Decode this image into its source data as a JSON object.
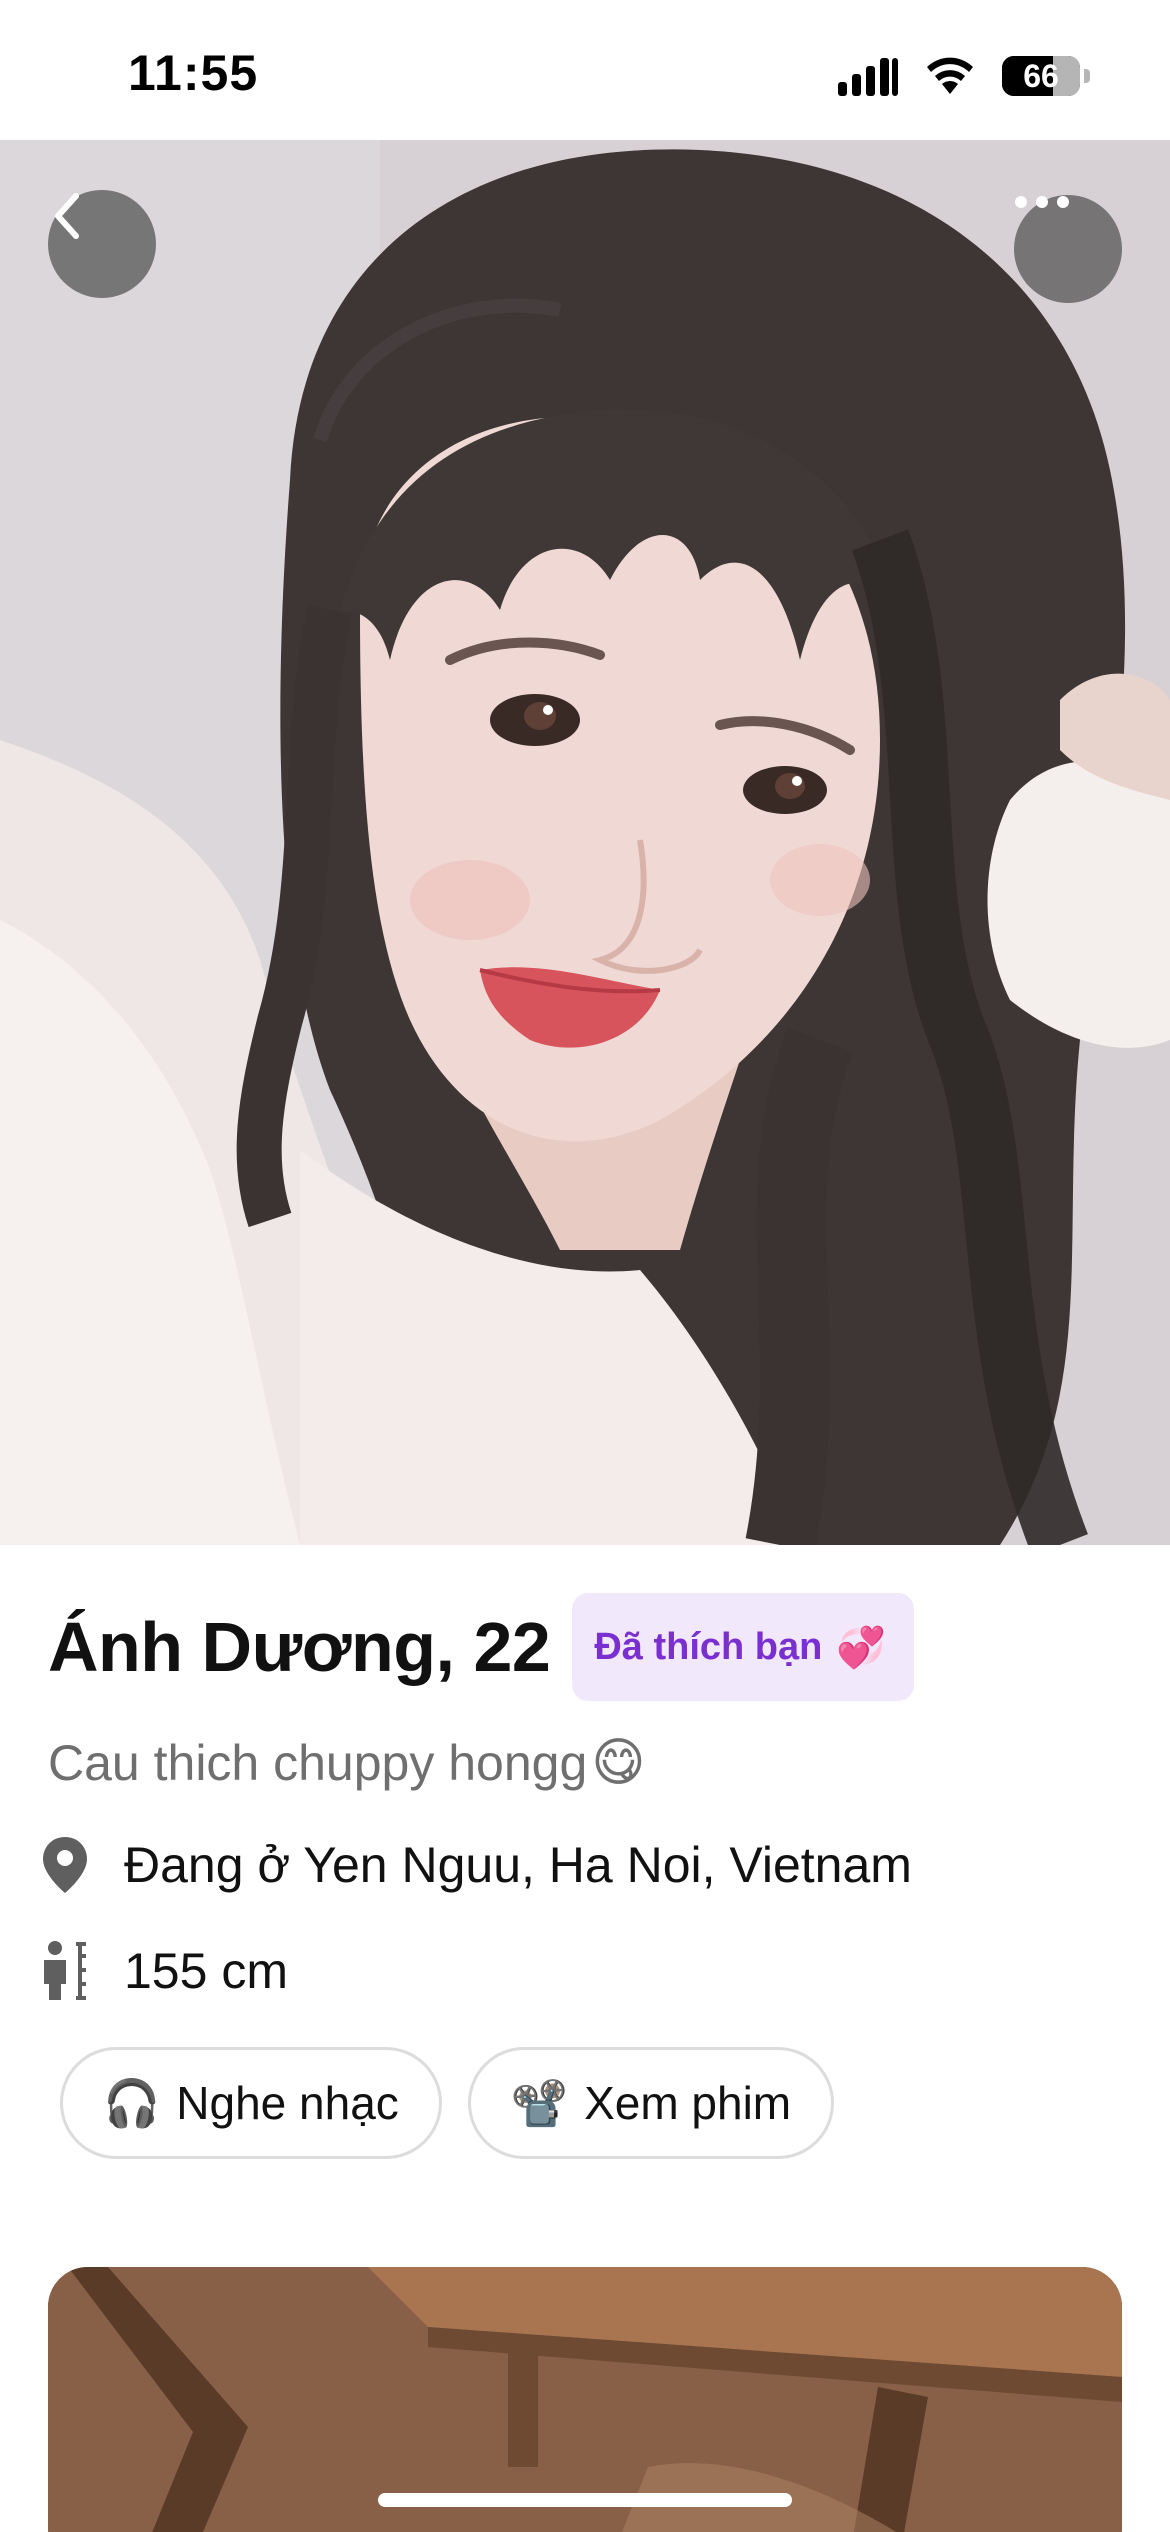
{
  "status_bar": {
    "time": "11:55",
    "battery_level": "66",
    "battery_fraction": 0.66,
    "icons": [
      "cellular-signal-icon",
      "wifi-icon",
      "battery-icon"
    ]
  },
  "hero": {
    "back_icon": "chevron-left-icon",
    "more_icon": "ellipsis-icon"
  },
  "profile": {
    "name_age": "Ánh Dương, 22",
    "liked_badge": "Đã thích bạn",
    "liked_emoji": "💞",
    "bio": "Cau thich chuppy hongg",
    "bio_emoji": "😋",
    "location": "Đang ở Yen Nguu, Ha Noi, Vietnam",
    "height": "155 cm",
    "interests": [
      {
        "icon": "🎧",
        "label": "Nghe nhạc"
      },
      {
        "icon": "📽️",
        "label": "Xem phim"
      }
    ]
  },
  "colors": {
    "badge_bg": "#f2e8fc",
    "badge_text": "#7a2fd0",
    "secondary_text": "#6f6f6f",
    "chip_border": "#dcdcdc"
  }
}
